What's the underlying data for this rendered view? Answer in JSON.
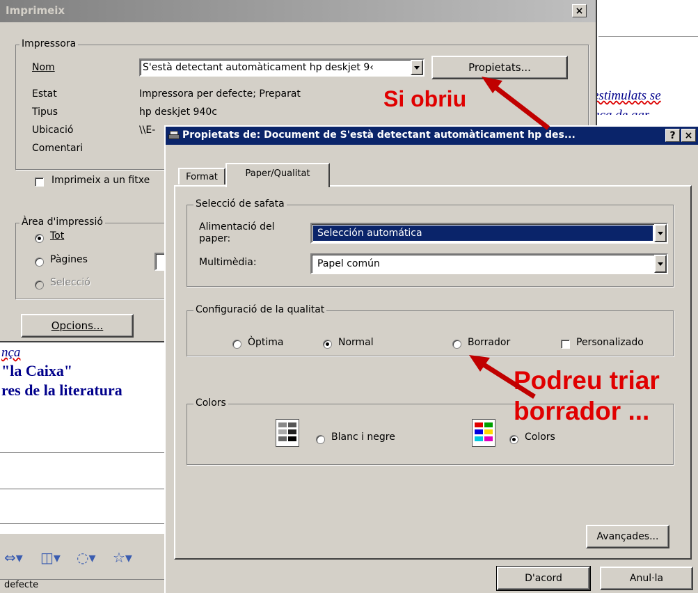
{
  "colors": {
    "dialog_bg": "#d4d0c8",
    "active_title": "#0a246a",
    "inactive_title": "#808080",
    "annotation": "#e00000",
    "doc_text": "#00008b"
  },
  "print_dialog": {
    "title": "Imprimeix",
    "close_glyph": "×",
    "printer_group": {
      "label": "Impressora",
      "name_label": "Nom",
      "name_value": "S'està detectant automàticament hp deskjet 9‹",
      "properties_button": "Propietats...",
      "status_label": "Estat",
      "status_value": "Impressora per defecte; Preparat",
      "type_label": "Tipus",
      "type_value": "hp deskjet 940c",
      "location_label": "Ubicació",
      "location_value": "\\\\E-",
      "comment_label": "Comentari",
      "print_to_file_label": "Imprimeix a un fitxe"
    },
    "print_range": {
      "label": "Àrea d'impressió",
      "all": "Tot",
      "pages": "Pàgines",
      "selection": "Selecció"
    },
    "options_button": "Opcions..."
  },
  "properties_dialog": {
    "title": "Propietats de: Document de S'està detectant automàticament hp des...",
    "help_glyph": "?",
    "close_glyph": "×",
    "tabs": [
      "Format",
      "Paper/Qualitat"
    ],
    "tray_group": {
      "label": "Selecció de safata",
      "source_label": "Alimentació del paper:",
      "source_value": "Selección automática",
      "media_label": "Multimèdia:",
      "media_value": "Papel común"
    },
    "quality_group": {
      "label": "Configuració de la qualitat",
      "options": [
        "Òptima",
        "Normal",
        "Borrador",
        "Personalizado"
      ],
      "selected": "Normal"
    },
    "colors_group": {
      "label": "Colors",
      "bw_label": "Blanc i negre",
      "color_label": "Colors",
      "selected": "Colors"
    },
    "advanced_button": "Avançades...",
    "ok_button": "D'acord",
    "cancel_button": "Anul·la"
  },
  "annotations": {
    "open_note": "Si obriu",
    "draft_note_line1": "Podreu triar",
    "draft_note_line2": "borrador ..."
  },
  "background_document": {
    "lines": [
      "nça",
      "\"la Caixa\"",
      "res de la literatura"
    ],
    "right_lines": [
      "estimulats se",
      "aca de aar"
    ],
    "status_text": "defecte"
  }
}
